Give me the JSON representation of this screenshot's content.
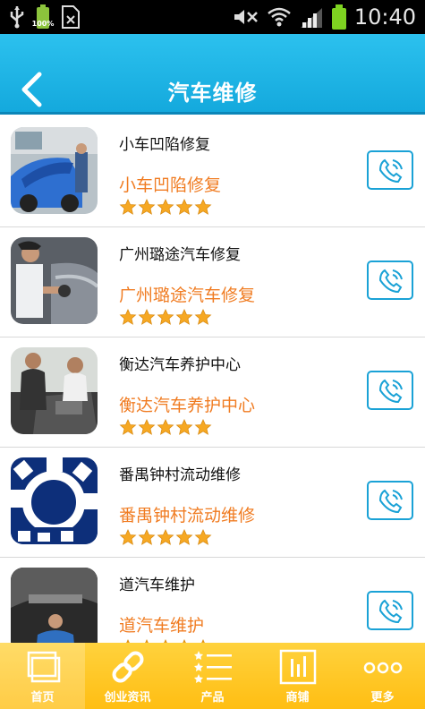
{
  "status_bar": {
    "time": "10:40",
    "battery_small_percent": "100%"
  },
  "header": {
    "title": "汽车维修"
  },
  "colors": {
    "header_blue": "#14a9dd",
    "accent_orange": "#f07c22",
    "nav_yellow": "#ffbe13"
  },
  "list": {
    "items": [
      {
        "title": "小车凹陷修复",
        "subtitle": "小车凹陷修复",
        "rating": 5
      },
      {
        "title": "广州璐途汽车修复",
        "subtitle": "广州璐途汽车修复",
        "rating": 5
      },
      {
        "title": "衡达汽车养护中心",
        "subtitle": "衡达汽车养护中心",
        "rating": 5
      },
      {
        "title": "番禺钟村流动维修",
        "subtitle": "番禺钟村流动维修",
        "rating": 5
      },
      {
        "title": "道汽车维护",
        "subtitle": "道汽车维护",
        "rating": 5
      }
    ]
  },
  "bottom_nav": {
    "items": [
      {
        "label": "首页",
        "icon": "home-icon"
      },
      {
        "label": "创业资讯",
        "icon": "link-icon"
      },
      {
        "label": "产品",
        "icon": "list-icon"
      },
      {
        "label": "商铺",
        "icon": "chart-icon"
      },
      {
        "label": "更多",
        "icon": "more-icon"
      }
    ]
  }
}
